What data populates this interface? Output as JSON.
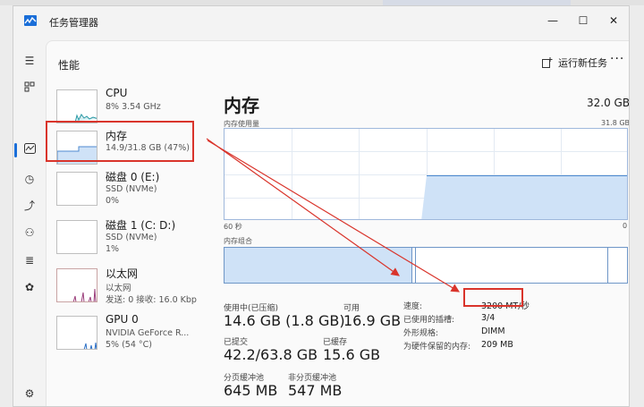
{
  "window": {
    "title": "任务管理器"
  },
  "page": {
    "title": "性能",
    "run_task": "运行新任务"
  },
  "perf_list": [
    {
      "title": "CPU",
      "line1": "8%  3.54 GHz",
      "line2": ""
    },
    {
      "title": "内存",
      "line1": "14.9/31.8 GB (47%)",
      "line2": ""
    },
    {
      "title": "磁盘 0 (E:)",
      "line1": "SSD (NVMe)",
      "line2": "0%"
    },
    {
      "title": "磁盘 1 (C: D:)",
      "line1": "SSD (NVMe)",
      "line2": "1%"
    },
    {
      "title": "以太网",
      "line1": "以太网",
      "line2": "发送: 0 接收: 16.0 Kbp"
    },
    {
      "title": "GPU 0",
      "line1": "NVIDIA GeForce R...",
      "line2": "5% (54 °C)"
    }
  ],
  "memory": {
    "title": "内存",
    "total": "32.0 GB",
    "usage_label": "内存使用量",
    "usage_max": "31.8 GB",
    "time_left": "60 秒",
    "time_right": "0",
    "composition_label": "内存组合",
    "usage_fraction": 0.47,
    "stats": {
      "in_use_label": "使用中(已压缩)",
      "in_use": "14.6 GB (1.8 GB)",
      "available_label": "可用",
      "available": "16.9 GB",
      "committed_label": "已提交",
      "committed": "42.2/63.8 GB",
      "cached_label": "已缓存",
      "cached": "15.6 GB",
      "paged_label": "分页缓冲池",
      "paged": "645 MB",
      "nonpaged_label": "非分页缓冲池",
      "nonpaged": "547 MB"
    },
    "details": [
      {
        "label": "速度:",
        "value": "3200 MT/秒"
      },
      {
        "label": "已使用的插槽:",
        "value": "3/4"
      },
      {
        "label": "外形规格:",
        "value": "DIMM"
      },
      {
        "label": "为硬件保留的内存:",
        "value": "209 MB"
      }
    ]
  },
  "colors": {
    "accent": "#1a6ed8",
    "highlight": "#d9342b",
    "graph_fill": "#cfe2f7",
    "graph_line": "#4f8bd0"
  },
  "icons": [
    "hamburger-menu-icon",
    "processes-icon",
    "performance-icon",
    "app-history-icon",
    "startup-apps-icon",
    "users-icon",
    "details-icon",
    "services-icon",
    "settings-icon"
  ]
}
